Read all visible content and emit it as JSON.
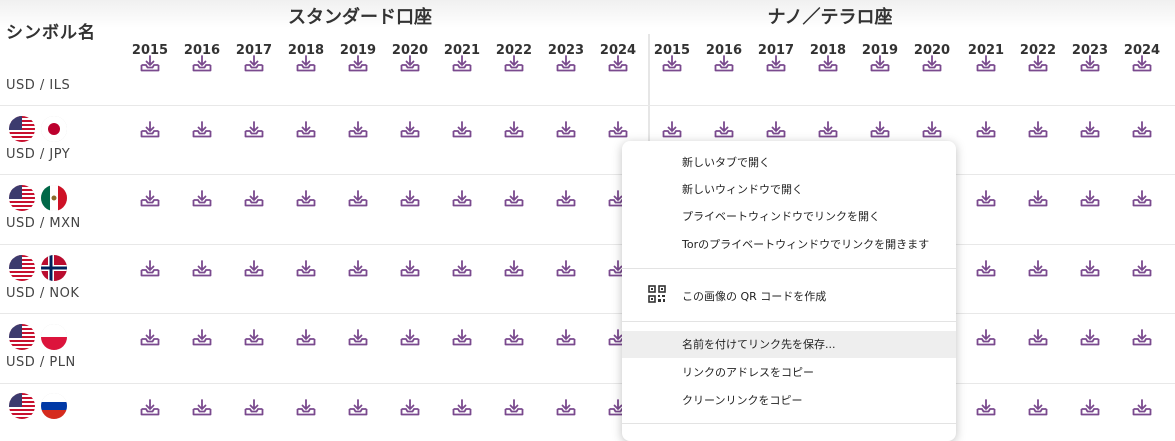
{
  "header": {
    "symbol_column": "シンボル名",
    "standard_group": "スタンダード口座",
    "nano_group": "ナノ／テラロ座",
    "years": [
      "2015",
      "2016",
      "2017",
      "2018",
      "2019",
      "2020",
      "2021",
      "2022",
      "2023",
      "2024"
    ]
  },
  "rows": [
    {
      "label": "USD / ILS"
    },
    {
      "label": "USD / JPY"
    },
    {
      "label": "USD / MXN"
    },
    {
      "label": "USD / NOK"
    },
    {
      "label": "USD / PLN"
    },
    {
      "label": ""
    }
  ],
  "icons": {
    "download": "download-tray-icon",
    "qr": "qr-code-icon"
  },
  "colors": {
    "accent": "#7a4a8e",
    "divider": "#e6e6e6"
  },
  "context_menu": {
    "items": [
      "新しいタブで開く",
      "新しいウィンドウで開く",
      "プライベートウィンドウでリンクを開く",
      "Torのプライベートウィンドウでリンクを開きます",
      "この画像の QR コードを作成",
      "名前を付けてリンク先を保存...",
      "リンクのアドレスをコピー",
      "クリーンリンクをコピー"
    ]
  }
}
